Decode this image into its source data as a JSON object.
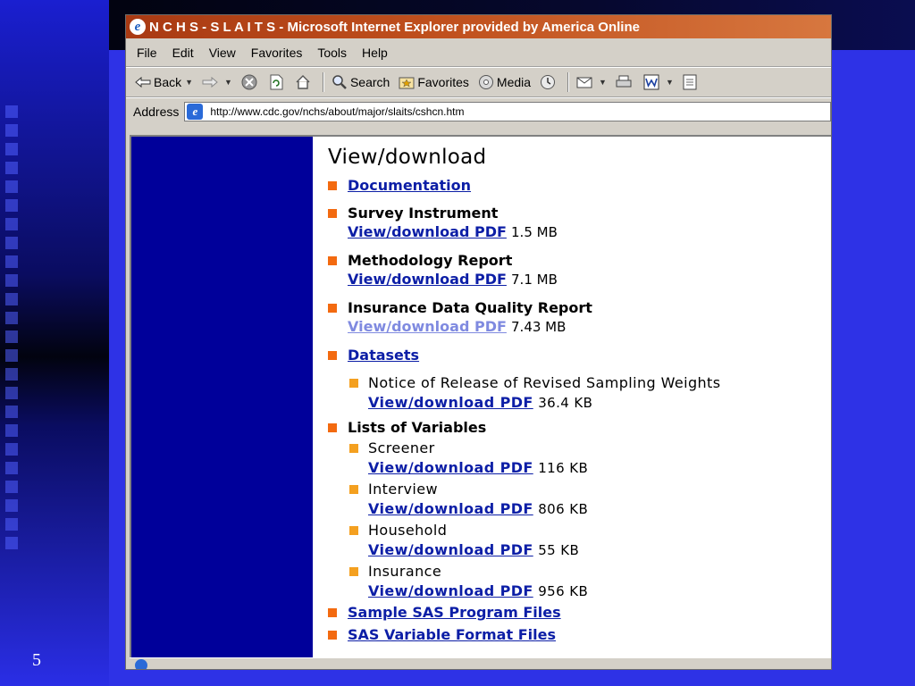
{
  "slide": {
    "number": "5"
  },
  "window": {
    "title": "N C H S -  S L A I T S - Microsoft Internet Explorer provided by America Online"
  },
  "menu": [
    "File",
    "Edit",
    "View",
    "Favorites",
    "Tools",
    "Help"
  ],
  "toolbar": {
    "back": "Back",
    "search": "Search",
    "favorites": "Favorites",
    "media": "Media"
  },
  "address": {
    "label": "Address",
    "url": "http://www.cdc.gov/nchs/about/major/slaits/cshcn.htm"
  },
  "page": {
    "heading": "View/download",
    "documentation": "Documentation",
    "survey": {
      "label": "Survey Instrument",
      "link": "View/download PDF",
      "size": "1.5 MB"
    },
    "methodology": {
      "label": "Methodology Report",
      "link": "View/download PDF",
      "size": "7.1 MB"
    },
    "insurance_quality": {
      "label": "Insurance Data Quality Report",
      "link": "View/download PDF",
      "size": "7.43 MB"
    },
    "datasets": "Datasets",
    "notice": {
      "label": "Notice of Release of Revised Sampling Weights",
      "link": "View/download PDF",
      "size": "36.4 KB"
    },
    "lists": "Lists of Variables",
    "screener": {
      "label": "Screener",
      "link": "View/download PDF",
      "size": "116 KB"
    },
    "interview": {
      "label": "Interview",
      "link": "View/download PDF",
      "size": "806 KB"
    },
    "household": {
      "label": "Household",
      "link": "View/download PDF",
      "size": "55 KB"
    },
    "insurance": {
      "label": "Insurance",
      "link": "View/download PDF",
      "size": "956 KB"
    },
    "sas_program": "Sample SAS Program Files",
    "sas_format": "SAS Variable Format Files"
  },
  "colors": {
    "slide_background": "#2e32e6",
    "title_bar": "#c0501d",
    "site_nav": "#00009a",
    "bullet": "#f36a10",
    "link": "#0c1ea6"
  }
}
